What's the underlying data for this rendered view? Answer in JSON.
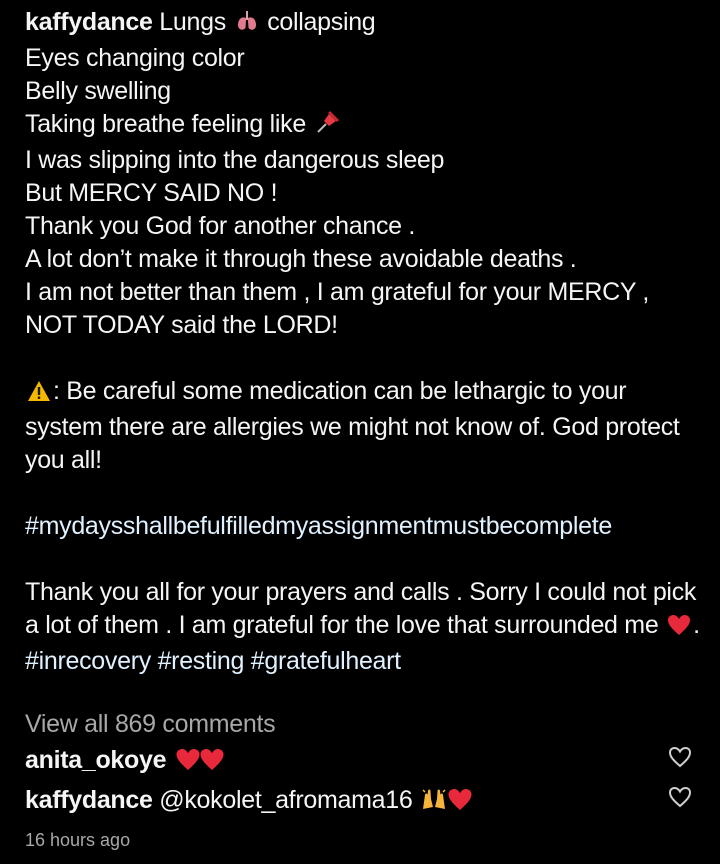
{
  "post": {
    "username": "kaffydance",
    "lines": [
      "Lungs",
      "collapsing",
      "Eyes changing color",
      "Belly swelling",
      "Taking breathe feeling like",
      "I was slipping into the dangerous sleep",
      "But MERCY SAID NO !",
      "Thank you God for another chance .",
      "A lot don’t make it through these avoidable deaths .",
      "I am not better than them , I am grateful for your MERCY , NOT TODAY said the LORD!"
    ],
    "warning_text": ": Be careful some medication can be lethargic to your system there are allergies we might not know of. God protect you all!",
    "hashtag_main": "#mydaysshallbefulfilledmyassignmentmustbecomplete",
    "thanks_text": "Thank you all for your prayers and calls . Sorry I could not pick a lot of them . I am grateful for the love that surrounded me",
    "thanks_end": ".",
    "hashtags": "#inrecovery #resting #gratefulheart",
    "emoji_names": [
      "lungs-emoji",
      "pushpin-emoji",
      "warning-emoji",
      "red-heart-emoji",
      "raising-hands-emoji"
    ]
  },
  "view_all_comments": "View all 869 comments",
  "comments": [
    {
      "username": "anita_okoye",
      "text": ""
    },
    {
      "username": "kaffydance",
      "text": "@kokolet_afromama16"
    }
  ],
  "timestamp": "16 hours ago",
  "colors": {
    "background": "#000000",
    "text": "#f5f5f5",
    "muted": "#a8a8a8",
    "hashtag": "#e0f1ff",
    "heart": "#e8293b"
  }
}
